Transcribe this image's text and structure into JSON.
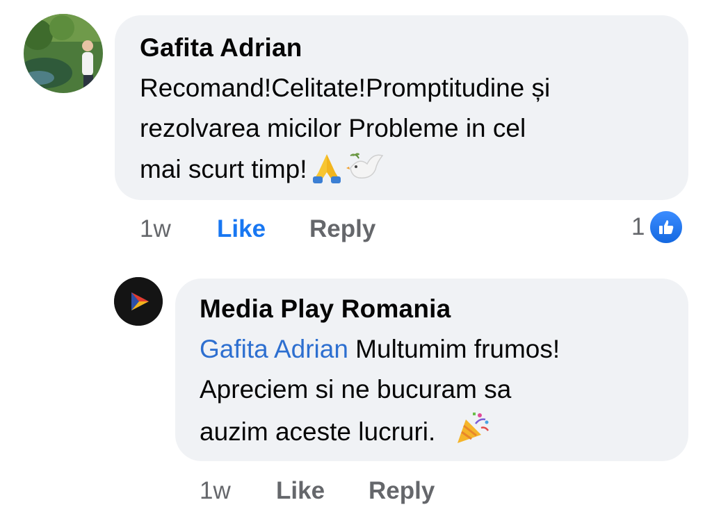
{
  "comment": {
    "author": "Gafita Adrian",
    "lines": [
      "Recomand!Celitate!Promptitudine și",
      "rezolvarea micilor Probleme in cel",
      "mai scurt timp!"
    ],
    "time": "1w",
    "like_label": "Like",
    "reply_label": "Reply",
    "reaction_count": "1",
    "reaction_icon": "thumbs-up-icon",
    "emojis": [
      "folded-hands-icon",
      "dove-icon"
    ]
  },
  "reply": {
    "author": "Media Play Romania",
    "mention": "Gafita Adrian",
    "line1_rest": " Multumim frumos!",
    "line2": "Apreciem si ne bucuram sa",
    "line3": "auzim aceste lucruri.",
    "time": "1w",
    "like_label": "Like",
    "reply_label": "Reply",
    "emojis": [
      "party-popper-icon"
    ]
  },
  "colors": {
    "bubble": "#f0f2f5",
    "link": "#2d6fd0",
    "like_active": "#1877f2",
    "meta": "#65676b"
  }
}
